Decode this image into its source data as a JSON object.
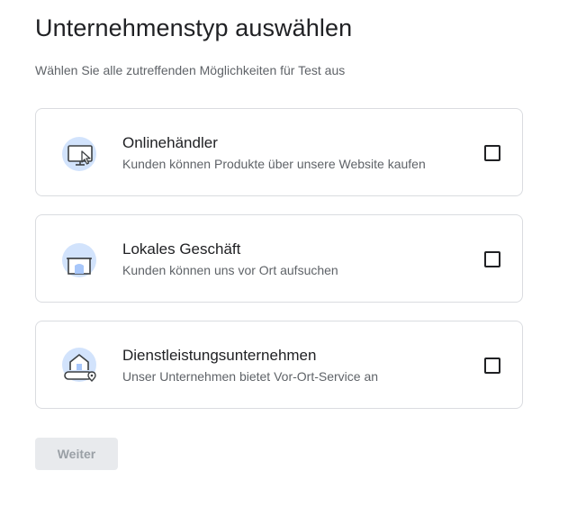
{
  "header": {
    "title": "Unternehmenstyp auswählen",
    "subtitle": "Wählen Sie alle zutreffenden Möglichkeiten für Test aus"
  },
  "options": [
    {
      "title": "Onlinehändler",
      "description": "Kunden können Produkte über unsere Website kaufen",
      "icon": "online-shop-monitor-icon",
      "checked": false
    },
    {
      "title": "Lokales Geschäft",
      "description": "Kunden können uns vor Ort aufsuchen",
      "icon": "storefront-icon",
      "checked": false
    },
    {
      "title": "Dienstleistungsunternehmen",
      "description": "Unser Unternehmen bietet Vor-Ort-Service an",
      "icon": "house-location-icon",
      "checked": false
    }
  ],
  "footer": {
    "next_label": "Weiter",
    "next_enabled": false
  },
  "colors": {
    "icon_circle": "#d2e3fc",
    "icon_stroke": "#3c4043",
    "border": "#dadce0",
    "disabled_bg": "#e8eaed",
    "disabled_text": "#9aa0a6"
  }
}
